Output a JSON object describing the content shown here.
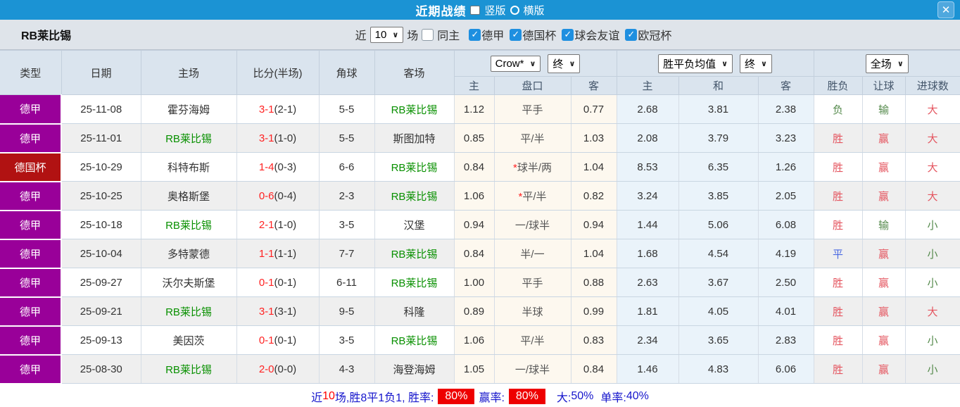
{
  "titlebar": {
    "title": "近期战绩",
    "vertical_label": "竖版",
    "horizontal_label": "横版",
    "close_label": "✕"
  },
  "filterbar": {
    "team": "RB莱比锡",
    "near_label": "近",
    "match_count": "10",
    "games_label": "场",
    "same_home_label": "同主",
    "league_labels": [
      "德甲",
      "德国杯",
      "球会友谊",
      "欧冠杯"
    ],
    "checkbox_states": {
      "same_home": false,
      "leagues": [
        true,
        true,
        true,
        true
      ]
    },
    "check_glyph": "✓"
  },
  "table": {
    "main_headers": {
      "type": "类型",
      "date": "日期",
      "home": "主场",
      "score": "比分(半场)",
      "corner": "角球",
      "away": "客场"
    },
    "dropdowns": {
      "company": "Crow*",
      "company_time": "终",
      "avg": "胜平负均值",
      "avg_time": "终",
      "scope": "全场",
      "chevron": "∨"
    },
    "subheaders": [
      "主",
      "盘口",
      "客",
      "主",
      "和",
      "客",
      "胜负",
      "让球",
      "进球数"
    ],
    "rows": [
      {
        "type": "德甲",
        "type_color": "purple",
        "date": "25-11-08",
        "home": "霍芬海姆",
        "home_color": "black",
        "score": "3-1",
        "half": "(2-1)",
        "corner": "5-5",
        "away": "RB莱比锡",
        "away_color": "tgreen",
        "ah_home": "1.12",
        "star": "",
        "handicap": "平手",
        "ah_away": "0.77",
        "win": "2.68",
        "draw": "3.81",
        "lose": "2.38",
        "result": "负",
        "result_color": "green",
        "let_result": "输",
        "let_color": "green",
        "goals": "大",
        "goals_color": "red"
      },
      {
        "type": "德甲",
        "type_color": "purple",
        "date": "25-11-01",
        "home": "RB莱比锡",
        "home_color": "tgreen",
        "score": "3-1",
        "half": "(1-0)",
        "corner": "5-5",
        "away": "斯图加特",
        "away_color": "black",
        "ah_home": "0.85",
        "star": "",
        "handicap": "平/半",
        "ah_away": "1.03",
        "win": "2.08",
        "draw": "3.79",
        "lose": "3.23",
        "result": "胜",
        "result_color": "red",
        "let_result": "赢",
        "let_color": "red",
        "goals": "大",
        "goals_color": "red"
      },
      {
        "type": "德国杯",
        "type_color": "darkred",
        "date": "25-10-29",
        "home": "科特布斯",
        "home_color": "black",
        "score": "1-4",
        "half": "(0-3)",
        "corner": "6-6",
        "away": "RB莱比锡",
        "away_color": "tgreen",
        "ah_home": "0.84",
        "star": "*",
        "handicap": "球半/两",
        "ah_away": "1.04",
        "win": "8.53",
        "draw": "6.35",
        "lose": "1.26",
        "result": "胜",
        "result_color": "red",
        "let_result": "赢",
        "let_color": "red",
        "goals": "大",
        "goals_color": "red"
      },
      {
        "type": "德甲",
        "type_color": "purple",
        "date": "25-10-25",
        "home": "奥格斯堡",
        "home_color": "black",
        "score": "0-6",
        "half": "(0-4)",
        "corner": "2-3",
        "away": "RB莱比锡",
        "away_color": "tgreen",
        "ah_home": "1.06",
        "star": "*",
        "handicap": "平/半",
        "ah_away": "0.82",
        "win": "3.24",
        "draw": "3.85",
        "lose": "2.05",
        "result": "胜",
        "result_color": "red",
        "let_result": "赢",
        "let_color": "red",
        "goals": "大",
        "goals_color": "red"
      },
      {
        "type": "德甲",
        "type_color": "purple",
        "date": "25-10-18",
        "home": "RB莱比锡",
        "home_color": "tgreen",
        "score": "2-1",
        "half": "(1-0)",
        "corner": "3-5",
        "away": "汉堡",
        "away_color": "black",
        "ah_home": "0.94",
        "star": "",
        "handicap": "一/球半",
        "ah_away": "0.94",
        "win": "1.44",
        "draw": "5.06",
        "lose": "6.08",
        "result": "胜",
        "result_color": "red",
        "let_result": "输",
        "let_color": "green",
        "goals": "小",
        "goals_color": "green"
      },
      {
        "type": "德甲",
        "type_color": "purple",
        "date": "25-10-04",
        "home": "多特蒙德",
        "home_color": "black",
        "score": "1-1",
        "half": "(1-1)",
        "corner": "7-7",
        "away": "RB莱比锡",
        "away_color": "tgreen",
        "ah_home": "0.84",
        "star": "",
        "handicap": "半/一",
        "ah_away": "1.04",
        "win": "1.68",
        "draw": "4.54",
        "lose": "4.19",
        "result": "平",
        "result_color": "blue",
        "let_result": "赢",
        "let_color": "red",
        "goals": "小",
        "goals_color": "green"
      },
      {
        "type": "德甲",
        "type_color": "purple",
        "date": "25-09-27",
        "home": "沃尔夫斯堡",
        "home_color": "black",
        "score": "0-1",
        "half": "(0-1)",
        "corner": "6-11",
        "away": "RB莱比锡",
        "away_color": "tgreen",
        "ah_home": "1.00",
        "star": "",
        "handicap": "平手",
        "ah_away": "0.88",
        "win": "2.63",
        "draw": "3.67",
        "lose": "2.50",
        "result": "胜",
        "result_color": "red",
        "let_result": "赢",
        "let_color": "red",
        "goals": "小",
        "goals_color": "green"
      },
      {
        "type": "德甲",
        "type_color": "purple",
        "date": "25-09-21",
        "home": "RB莱比锡",
        "home_color": "tgreen",
        "score": "3-1",
        "half": "(3-1)",
        "corner": "9-5",
        "away": "科隆",
        "away_color": "black",
        "ah_home": "0.89",
        "star": "",
        "handicap": "半球",
        "ah_away": "0.99",
        "win": "1.81",
        "draw": "4.05",
        "lose": "4.01",
        "result": "胜",
        "result_color": "red",
        "let_result": "赢",
        "let_color": "red",
        "goals": "大",
        "goals_color": "red"
      },
      {
        "type": "德甲",
        "type_color": "purple",
        "date": "25-09-13",
        "home": "美因茨",
        "home_color": "black",
        "score": "0-1",
        "half": "(0-1)",
        "corner": "3-5",
        "away": "RB莱比锡",
        "away_color": "tgreen",
        "ah_home": "1.06",
        "star": "",
        "handicap": "平/半",
        "ah_away": "0.83",
        "win": "2.34",
        "draw": "3.65",
        "lose": "2.83",
        "result": "胜",
        "result_color": "red",
        "let_result": "赢",
        "let_color": "red",
        "goals": "小",
        "goals_color": "green"
      },
      {
        "type": "德甲",
        "type_color": "purple",
        "date": "25-08-30",
        "home": "RB莱比锡",
        "home_color": "tgreen",
        "score": "2-0",
        "half": "(0-0)",
        "corner": "4-3",
        "away": "海登海姆",
        "away_color": "black",
        "ah_home": "1.05",
        "star": "",
        "handicap": "一/球半",
        "ah_away": "0.84",
        "win": "1.46",
        "draw": "4.83",
        "lose": "6.06",
        "result": "胜",
        "result_color": "red",
        "let_result": "赢",
        "let_color": "red",
        "goals": "小",
        "goals_color": "green"
      }
    ]
  },
  "footer": {
    "near_label": "近",
    "count": "10",
    "summary": "场,胜8平1负1, 胜率:",
    "win_rate": "80%",
    "earn_label": "赢率:",
    "earn_rate": "80%",
    "big_label": "大:",
    "big_rate": "50%",
    "single_label": "单率:",
    "single_rate": "40%"
  },
  "colors": {
    "topbar_blue": "#1b93d4",
    "bundesliga_badge": "#990099",
    "german_cup_badge": "#b11212",
    "team_green": "#089000",
    "score_red": "#ff2222",
    "result_red": "#e4555f",
    "result_green": "#558a4c",
    "draw_blue": "#4a69e2",
    "rate_badge_red": "#ee0000",
    "footer_blue": "#1515cc",
    "ah_column_bg": "#fdf8ef",
    "wdl_column_bg": "#eaf3fa"
  }
}
